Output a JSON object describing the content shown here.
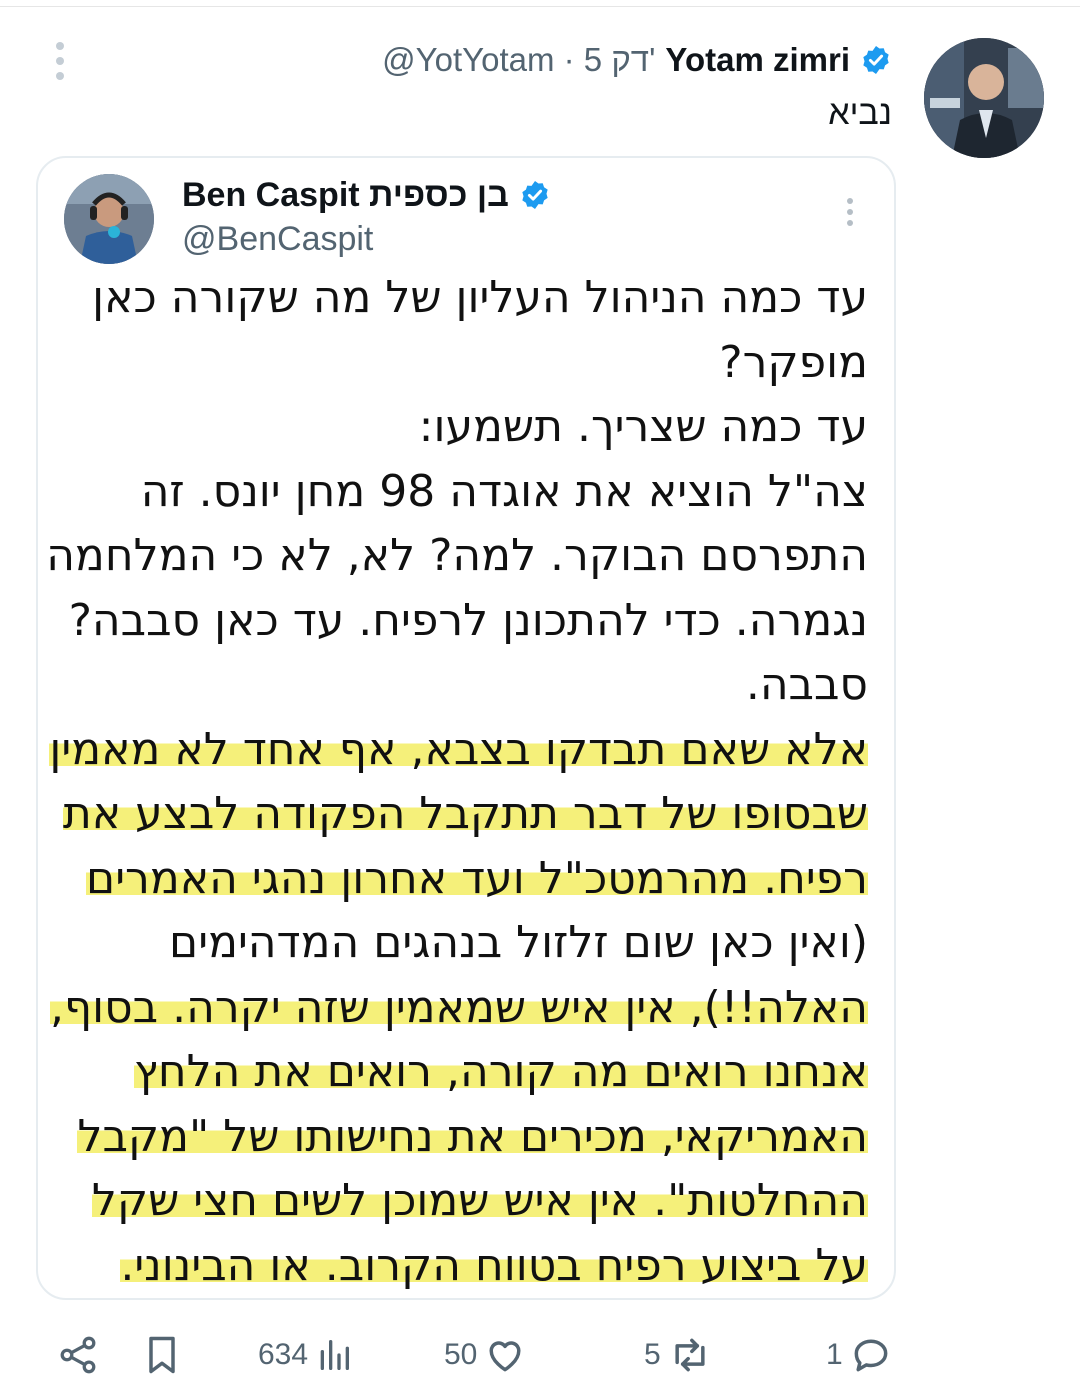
{
  "post": {
    "author_name": "Yotam zimri",
    "handle_time": "@YotYotam · 5 דק'",
    "text": "נביא"
  },
  "quote": {
    "author_name": "Ben Caspit בן כספית",
    "handle": "@BenCaspit",
    "lines": [
      {
        "text": "עד כמה הניהול העליון של מה שקורה כאן",
        "highlight": false
      },
      {
        "text": "מופקר?",
        "highlight": false
      },
      {
        "text": "עד כמה שצריך. תשמעו:",
        "highlight": false
      },
      {
        "text": "צה\"ל הוציא את אוגדה 98 מחן יונס. זה",
        "highlight": false
      },
      {
        "text": "התפרסם הבוקר. למה? לא, לא כי המלחמה",
        "highlight": false
      },
      {
        "text": "נגמרה. כדי להתכונן לרפיח. עד כאן סבבה?",
        "highlight": false
      },
      {
        "text": "סבבה.",
        "highlight": false
      },
      {
        "text": "אלא שאם תבדקו בצבא, אף אחד לא מאמין",
        "highlight": true
      },
      {
        "text": "שבסופו של דבר תתקבל הפקודה לבצע את",
        "highlight": true
      },
      {
        "text": "רפיח. מהרמטכ\"ל ועד אחרון נהגי האמרים",
        "highlight": true
      },
      {
        "text": "(ואין כאן שום זלזול בנהגים המדהימים",
        "highlight": false
      },
      {
        "text": "האלה!!), אין איש שמאמין שזה יקרה. בסוף,",
        "highlight": true
      },
      {
        "text": "אנחנו רואים מה קורה, רואים את הלחץ",
        "highlight": true
      },
      {
        "text": "האמריקאי, מכירים את נחישותו של \"מקבל",
        "highlight": true
      },
      {
        "text": "ההחלטות\". אין איש שמוכן לשים חצי שקל",
        "highlight": true
      },
      {
        "text": "על ביצוע רפיח בטווח הקרוב. או הבינוני.",
        "highlight": true
      }
    ]
  },
  "actions": {
    "views": "634",
    "likes": "50",
    "reposts": "5",
    "replies": "1"
  },
  "colors": {
    "verified": "#1d9bf0",
    "highlight": "#f5f07a",
    "muted_text": "#536471"
  },
  "icons": [
    "share-icon",
    "bookmark-icon",
    "views-icon",
    "heart-icon",
    "repost-icon",
    "reply-icon",
    "verified-icon",
    "more-icon"
  ]
}
